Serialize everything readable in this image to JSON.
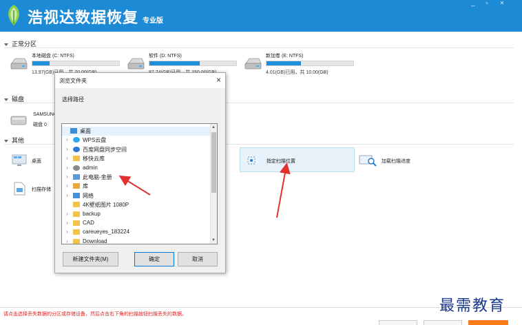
{
  "app": {
    "title": "浩视达数据恢复",
    "edition": "专业版",
    "window_controls": [
      "_",
      "▫",
      "×"
    ],
    "brand_color": "#1d8ad6"
  },
  "sections": {
    "normal_partitions": "正常分区",
    "disks": "磁盘",
    "others": "其他"
  },
  "drives": [
    {
      "name": "本地磁盘 (C: NTFS)",
      "size": "13.97(GB)已用，共 70.00(GB)",
      "used": 0.2
    },
    {
      "name": "软件 (D: NTFS)",
      "size": "87.74(GB)已用，共 150.00(GB)",
      "used": 0.58
    },
    {
      "name": "新加卷 (E: NTFS)",
      "size": "4.01(GB)已用，共 10.00(GB)",
      "used": 0.4
    }
  ],
  "disk": {
    "name": "SAMSUNG",
    "label": "磁盘 0"
  },
  "tools": {
    "desktop": "桌面",
    "scan_file": "扫描存储",
    "specify_location": "指定扫描位置",
    "load_progress": "加载扫描进度"
  },
  "dialog": {
    "title": "浏览文件夹",
    "close": "×",
    "caption": "选择路径",
    "tree": [
      {
        "label": "桌面",
        "icon": "desktop-icon",
        "level": 0,
        "expandable": false,
        "selected": true
      },
      {
        "label": "WPS云盘",
        "icon": "cloud-icon",
        "level": 1,
        "expandable": true
      },
      {
        "label": "百度网盘同步空间",
        "icon": "cloud-sync-icon",
        "level": 1,
        "expandable": true
      },
      {
        "label": "移快云库",
        "icon": "folder-icon",
        "level": 1,
        "expandable": true
      },
      {
        "label": "admin",
        "icon": "user-icon",
        "level": 1,
        "expandable": true
      },
      {
        "label": "此电脑-金册",
        "icon": "computer-icon",
        "level": 1,
        "expandable": true
      },
      {
        "label": "库",
        "icon": "library-icon",
        "level": 1,
        "expandable": true
      },
      {
        "label": "网络",
        "icon": "network-icon",
        "level": 1,
        "expandable": true
      },
      {
        "label": "4K壁纸图片 1080P",
        "icon": "folder-icon",
        "level": 1,
        "expandable": false
      },
      {
        "label": "backup",
        "icon": "folder-icon",
        "level": 1,
        "expandable": true
      },
      {
        "label": "CAD",
        "icon": "folder-icon",
        "level": 1,
        "expandable": true
      },
      {
        "label": "careueyes_183224",
        "icon": "folder-icon",
        "level": 1,
        "expandable": true
      },
      {
        "label": "Download",
        "icon": "folder-icon",
        "level": 1,
        "expandable": true
      }
    ],
    "new_folder": "新建文件夹(M)",
    "ok": "确定",
    "cancel": "取消"
  },
  "status": {
    "text": "请点击选择丢失数据的分区或存储设备，然后点击右下角的扫描按钮扫描丢失的数据。",
    "color": "#e02020"
  },
  "watermark": "最需教育"
}
